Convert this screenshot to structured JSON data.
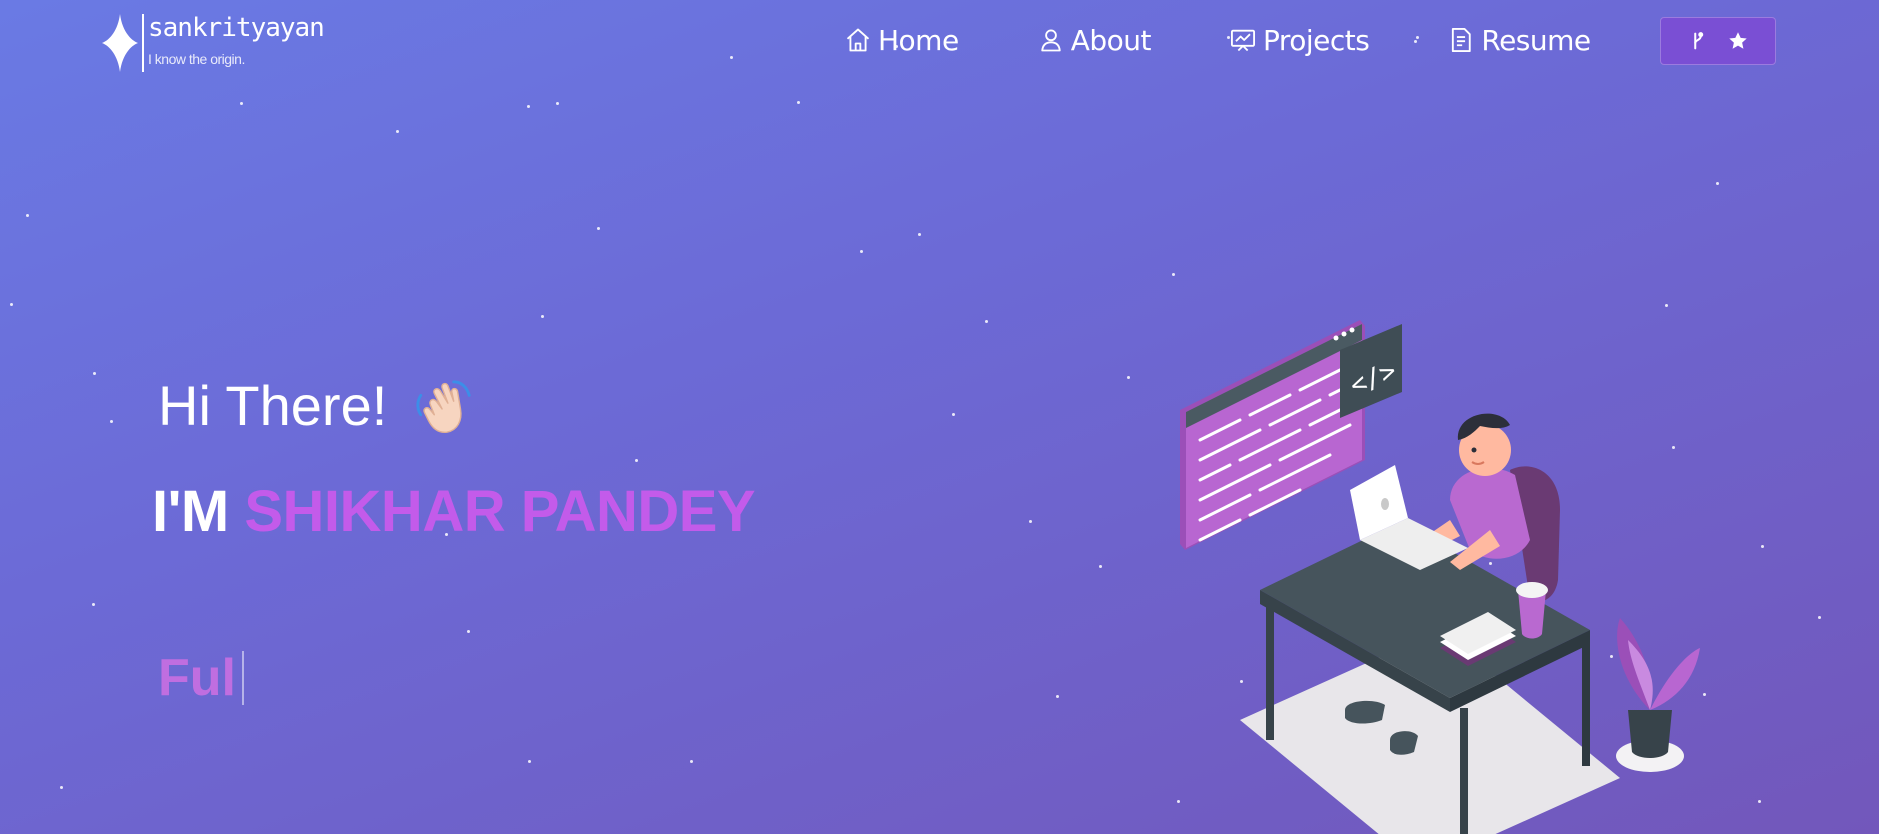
{
  "brand": {
    "name": "sankrityayan",
    "tagline": "I know the origin."
  },
  "nav": {
    "items": [
      {
        "label": "Home",
        "icon": "home-icon"
      },
      {
        "label": "About",
        "icon": "user-icon"
      },
      {
        "label": "Projects",
        "icon": "projects-icon"
      },
      {
        "label": "Resume",
        "icon": "document-icon"
      }
    ],
    "github_button": {
      "icons": [
        "fork-icon",
        "star-icon"
      ]
    }
  },
  "hero": {
    "greeting": "Hi There!",
    "name_prefix": "I'M",
    "name": "SHIKHAR PANDEY",
    "typed_text": "Ful"
  },
  "colors": {
    "background_start": "#6a7ae4",
    "background_end": "#7257bb",
    "accent": "#c35bea",
    "button": "#7a4fd4"
  }
}
